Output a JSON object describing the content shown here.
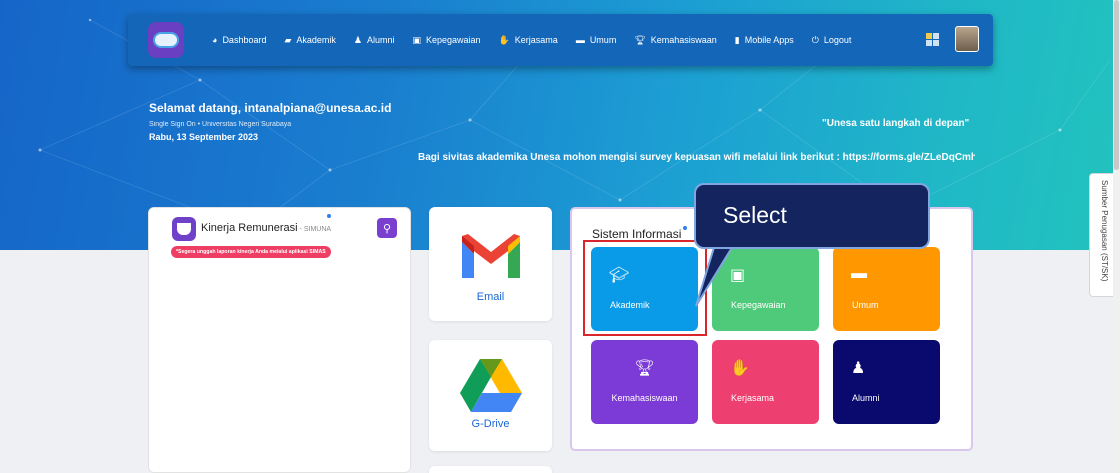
{
  "nav": {
    "items": [
      {
        "label": "Dashboard",
        "icon": "dashboard-icon"
      },
      {
        "label": "Akademik",
        "icon": "graduation-cap-icon"
      },
      {
        "label": "Alumni",
        "icon": "user-graduate-icon"
      },
      {
        "label": "Kepegawaian",
        "icon": "id-card-icon"
      },
      {
        "label": "Kerjasama",
        "icon": "handshake-icon"
      },
      {
        "label": "Umum",
        "icon": "comment-icon"
      },
      {
        "label": "Kemahasiswaan",
        "icon": "trophy-icon"
      },
      {
        "label": "Mobile Apps",
        "icon": "mobile-icon"
      },
      {
        "label": "Logout",
        "icon": "power-icon"
      }
    ]
  },
  "welcome": {
    "greeting": "Selamat datang, intanalpiana@unesa.ac.id",
    "breadcrumb": "Single Sign On  •  Universitas Negeri Surabaya",
    "date": "Rabu, 13 September 2023"
  },
  "motto": "\"Unesa satu langkah di depan\"",
  "survey": "Bagi sivitas akademika Unesa mohon mengisi survey kepuasan wifi melalui link berikut :  https://forms.gle/ZLeDqCmhbt",
  "side_tab": "Sumber Penugasan (ST/SK)",
  "kinerja": {
    "title": "Kinerja Remunerasi",
    "subtitle": " - SIMUNA",
    "alert": "*Segera unggah laporan kinerja Anda melalui aplikasi SIMAS"
  },
  "apps": {
    "email": "Email",
    "gdrive": "G-Drive"
  },
  "sistem_informasi": {
    "title": "Sistem Informasi",
    "tiles": [
      {
        "label": "Akademik",
        "color": "#0a9be8",
        "icon": "graduation-cap-icon"
      },
      {
        "label": "Kepegawaian",
        "color": "#4fc97a",
        "icon": "id-card-icon"
      },
      {
        "label": "Umum",
        "color": "#ff9800",
        "icon": "comment-icon"
      },
      {
        "label": "Kemahasiswaan",
        "color": "#7c3ad6",
        "icon": "trophy-icon"
      },
      {
        "label": "Kerjasama",
        "color": "#ee4070",
        "icon": "handshake-icon"
      },
      {
        "label": "Alumni",
        "color": "#0a0a6e",
        "icon": "user-graduate-icon"
      }
    ]
  },
  "annotation": {
    "callout": "Select",
    "highlight_color": "#d9262c"
  }
}
